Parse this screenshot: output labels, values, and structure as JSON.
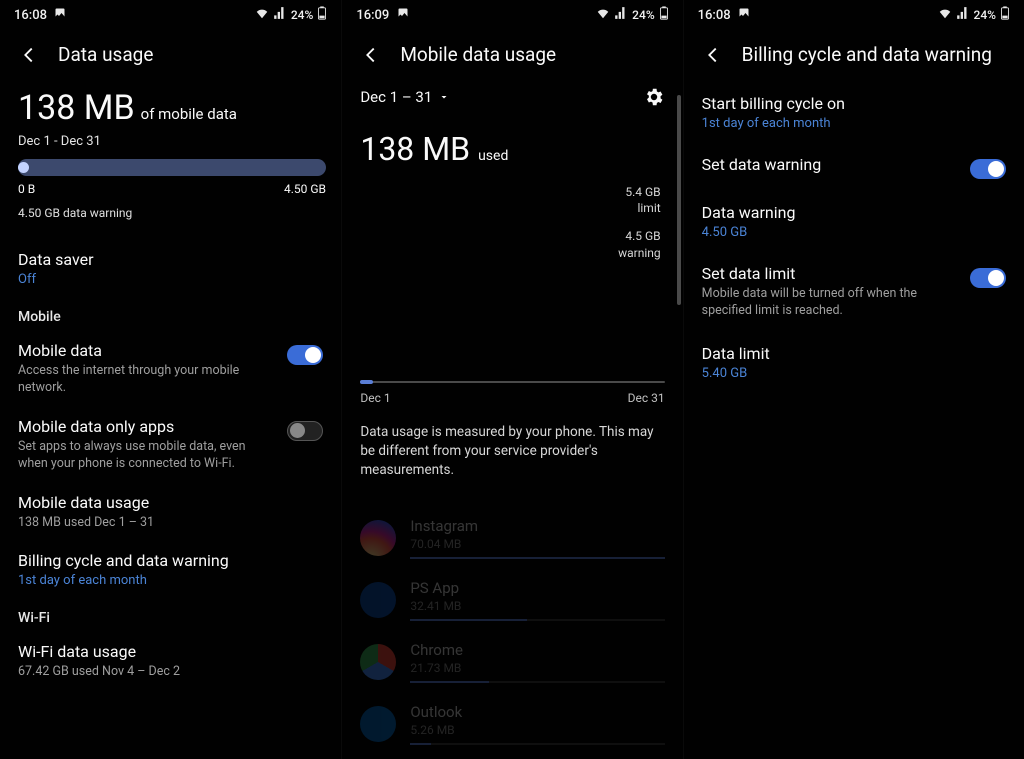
{
  "screen1": {
    "status": {
      "time": "16:08",
      "battery": "24%"
    },
    "header": "Data usage",
    "usage_value": "138 MB",
    "usage_suffix": "of mobile data",
    "date_range": "Dec 1 - Dec 31",
    "bar_min": "0 B",
    "bar_max": "4.50 GB",
    "warning_note": "4.50 GB data warning",
    "data_saver": {
      "title": "Data saver",
      "value": "Off"
    },
    "group_mobile": "Mobile",
    "mobile_data": {
      "title": "Mobile data",
      "sub": "Access the internet through your mobile network.",
      "on": true
    },
    "only_apps": {
      "title": "Mobile data only apps",
      "sub": "Set apps to always use mobile data, even when your phone is connected to Wi-Fi.",
      "on": false
    },
    "mobile_usage": {
      "title": "Mobile data usage",
      "sub": "138 MB used Dec 1 – 31"
    },
    "billing": {
      "title": "Billing cycle and data warning",
      "value": "1st day of each month"
    },
    "group_wifi": "Wi-Fi",
    "wifi_usage": {
      "title": "Wi-Fi data usage",
      "sub": "67.42 GB used Nov 4 – Dec 2"
    }
  },
  "screen2": {
    "status": {
      "time": "16:09",
      "battery": "24%"
    },
    "header": "Mobile data usage",
    "period": "Dec 1 – 31",
    "usage_value": "138 MB",
    "usage_suffix": "used",
    "limit": {
      "value": "5.4 GB",
      "label": "limit"
    },
    "warning": {
      "value": "4.5 GB",
      "label": "warning"
    },
    "chart": {
      "start": "Dec 1",
      "end": "Dec 31"
    },
    "note": "Data usage is measured by your phone. This may be different from your service provider's measurements.",
    "apps": [
      {
        "name": "Instagram",
        "size": "70.04 MB",
        "pct": 100,
        "ico": "ig"
      },
      {
        "name": "PS App",
        "size": "32.41 MB",
        "pct": 46,
        "ico": "ps"
      },
      {
        "name": "Chrome",
        "size": "21.73 MB",
        "pct": 31,
        "ico": "ch"
      },
      {
        "name": "Outlook",
        "size": "5.26 MB",
        "pct": 8,
        "ico": "ol"
      }
    ]
  },
  "screen3": {
    "status": {
      "time": "16:08",
      "battery": "24%"
    },
    "header": "Billing cycle and data warning",
    "start_cycle": {
      "title": "Start billing cycle on",
      "value": "1st day of each month"
    },
    "set_warning": {
      "title": "Set data warning",
      "on": true
    },
    "data_warning": {
      "title": "Data warning",
      "value": "4.50 GB"
    },
    "set_limit": {
      "title": "Set data limit",
      "sub": "Mobile data will be turned off when the specified limit is reached.",
      "on": true
    },
    "data_limit": {
      "title": "Data limit",
      "value": "5.40 GB"
    }
  },
  "chart_data": {
    "type": "bar",
    "title": "Mobile data usage Dec 1 – 31",
    "xlabel": "",
    "ylabel": "",
    "categories": [
      "Dec 1",
      "Dec 31"
    ],
    "series": [
      {
        "name": "used",
        "values": [
          138,
          0
        ]
      }
    ],
    "limit_gb": 5.4,
    "warning_gb": 4.5
  }
}
